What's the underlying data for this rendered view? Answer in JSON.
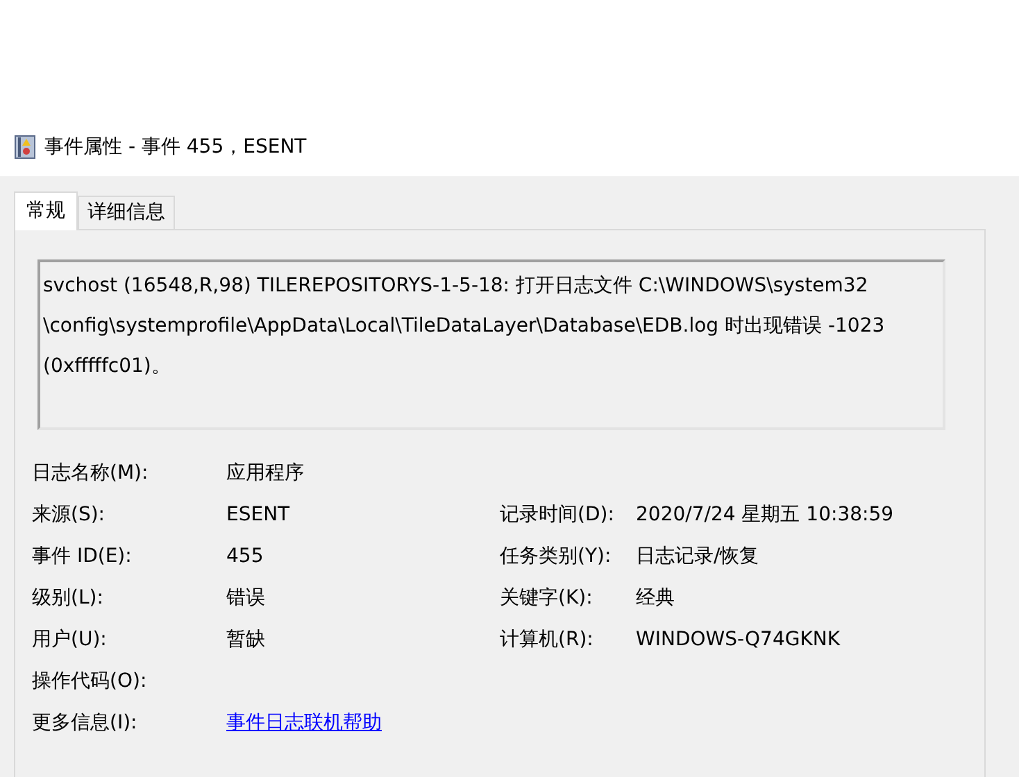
{
  "window": {
    "title": "事件属性 - 事件 455，ESENT"
  },
  "tabs": [
    {
      "label": "常规",
      "selected": true
    },
    {
      "label": "详细信息",
      "selected": false
    }
  ],
  "description": {
    "lines": [
      "svchost (16548,R,98) TILEREPOSITORYS-1-5-18: 打开日志文件 C:\\WINDOWS\\system32",
      "\\config\\systemprofile\\AppData\\Local\\TileDataLayer\\Database\\EDB.log 时出现错误 -1023",
      "(0xfffffc01)。"
    ]
  },
  "fields": [
    {
      "label": "日志名称(M):",
      "value": "应用程序"
    },
    {
      "label": "来源(S):",
      "value": "ESENT",
      "right_label": "记录时间(D):",
      "right_value": "2020/7/24 星期五 10:38:59"
    },
    {
      "label": "事件 ID(E):",
      "value": "455",
      "right_label": "任务类别(Y):",
      "right_value": "日志记录/恢复"
    },
    {
      "label": "级别(L):",
      "value": "错误",
      "right_label": "关键字(K):",
      "right_value": "经典"
    },
    {
      "label": "用户(U):",
      "value": "暂缺",
      "right_label": "计算机(R):",
      "right_value": "WINDOWS-Q74GKNK"
    },
    {
      "label": "操作代码(O):"
    },
    {
      "label": "更多信息(I):",
      "value": "事件日志联机帮助",
      "kind": "link"
    }
  ]
}
